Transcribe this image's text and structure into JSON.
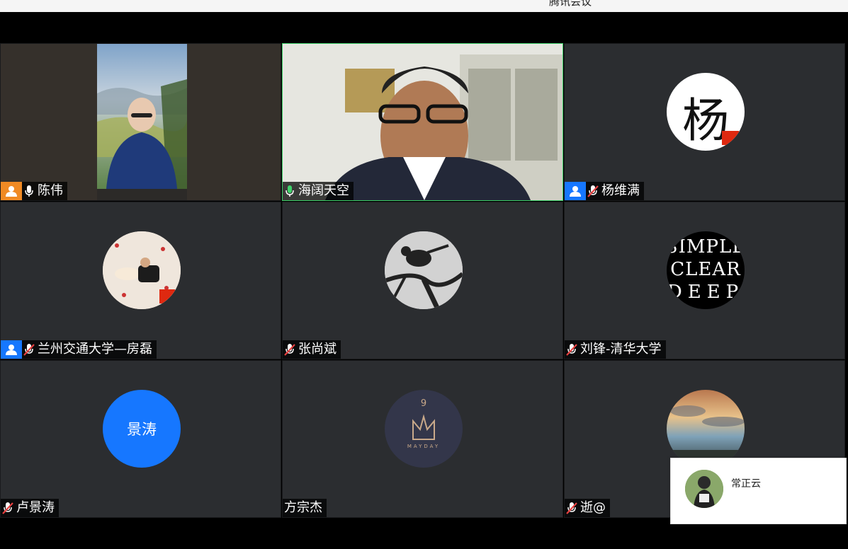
{
  "window": {
    "title": "腾讯会议"
  },
  "participants": [
    {
      "name": "陈伟",
      "mic": "on",
      "badge": "orange-user"
    },
    {
      "name": "海阔天空",
      "mic": "speaking",
      "badge": ""
    },
    {
      "name": "杨维满",
      "mic": "muted",
      "badge": "blue-user",
      "avatar_text": "杨"
    },
    {
      "name": "兰州交通大学—房磊",
      "mic": "muted",
      "badge": "blue-user"
    },
    {
      "name": "张尚斌",
      "mic": "muted",
      "badge": ""
    },
    {
      "name": "刘锋-清华大学",
      "mic": "muted",
      "badge": "",
      "avatar_text": [
        "SIMPLE",
        "CLEAR",
        "DEEP"
      ]
    },
    {
      "name": "卢景涛",
      "mic": "muted",
      "badge": "",
      "avatar_text": "景涛"
    },
    {
      "name": "方宗杰",
      "mic": "none",
      "badge": "",
      "avatar_text": [
        "9",
        "MAYDAY"
      ]
    },
    {
      "name": "逝@",
      "mic": "muted",
      "badge": ""
    }
  ],
  "notification": {
    "name": "常正云"
  },
  "colors": {
    "active_border": "#3fd26b",
    "tile_bg": "#2b2d30",
    "blue_badge": "#1677ff",
    "orange_badge": "#f08a24",
    "muted_red": "#e94040"
  }
}
